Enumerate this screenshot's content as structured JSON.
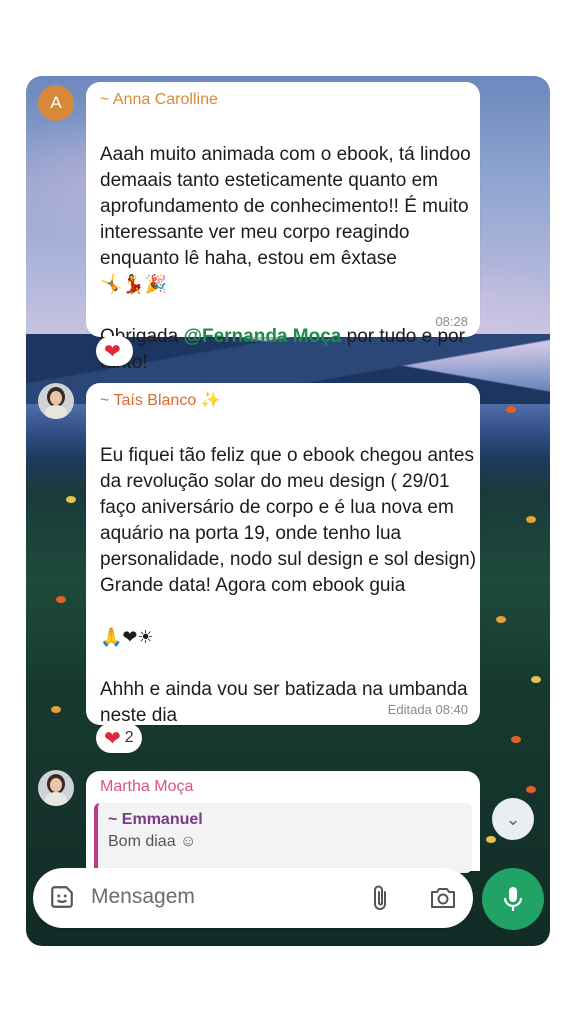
{
  "messages": [
    {
      "sender": "~ Anna Carolline",
      "avatar_letter": "A",
      "text": "Aaah muito animada com o ebook, tá lindoo demaais tanto esteticamente quanto em aprofundamento de conhecimento!! É muito interessante ver meu corpo reagindo enquanto lê haha, estou em êxtase",
      "emojis": "🤸💃🎉",
      "text2_prefix": "Obrigada ",
      "mention": "@Fernanda Moça",
      "text2_suffix": " por tudo e por tanto!",
      "time": "08:28",
      "reaction": "❤"
    },
    {
      "sender": "~ Taís Blanco ✨",
      "text": "Eu fiquei tão feliz que o ebook chegou antes da revolução solar do meu design ( 29/01 faço aniversário de corpo e é lua nova em aquário na porta 19, onde tenho lua personalidade, nodo sul design e sol design)\nGrande data! Agora com ebook guia",
      "emojis": "🙏❤☀",
      "text2": "Ahhh e ainda vou ser batizada na umbanda neste dia",
      "emojis2": "🙌",
      "time": "Editada 08:40",
      "reaction": "❤",
      "reaction_count": "2"
    },
    {
      "sender": "Martha Moça",
      "quote_name": "~ Emmanuel",
      "quote_text": "Bom diaa ☺"
    }
  ],
  "composer": {
    "placeholder": "Mensagem"
  },
  "icons": {
    "scroll_down": "chevron-double-down-icon",
    "sticker": "sticker-icon",
    "attach": "paperclip-icon",
    "camera": "camera-icon",
    "mic": "microphone-icon"
  },
  "colors": {
    "accent_green": "#21a366",
    "name_anna": "#d98a35",
    "name_tais": "#e0672f",
    "name_martha": "#e0508a"
  }
}
